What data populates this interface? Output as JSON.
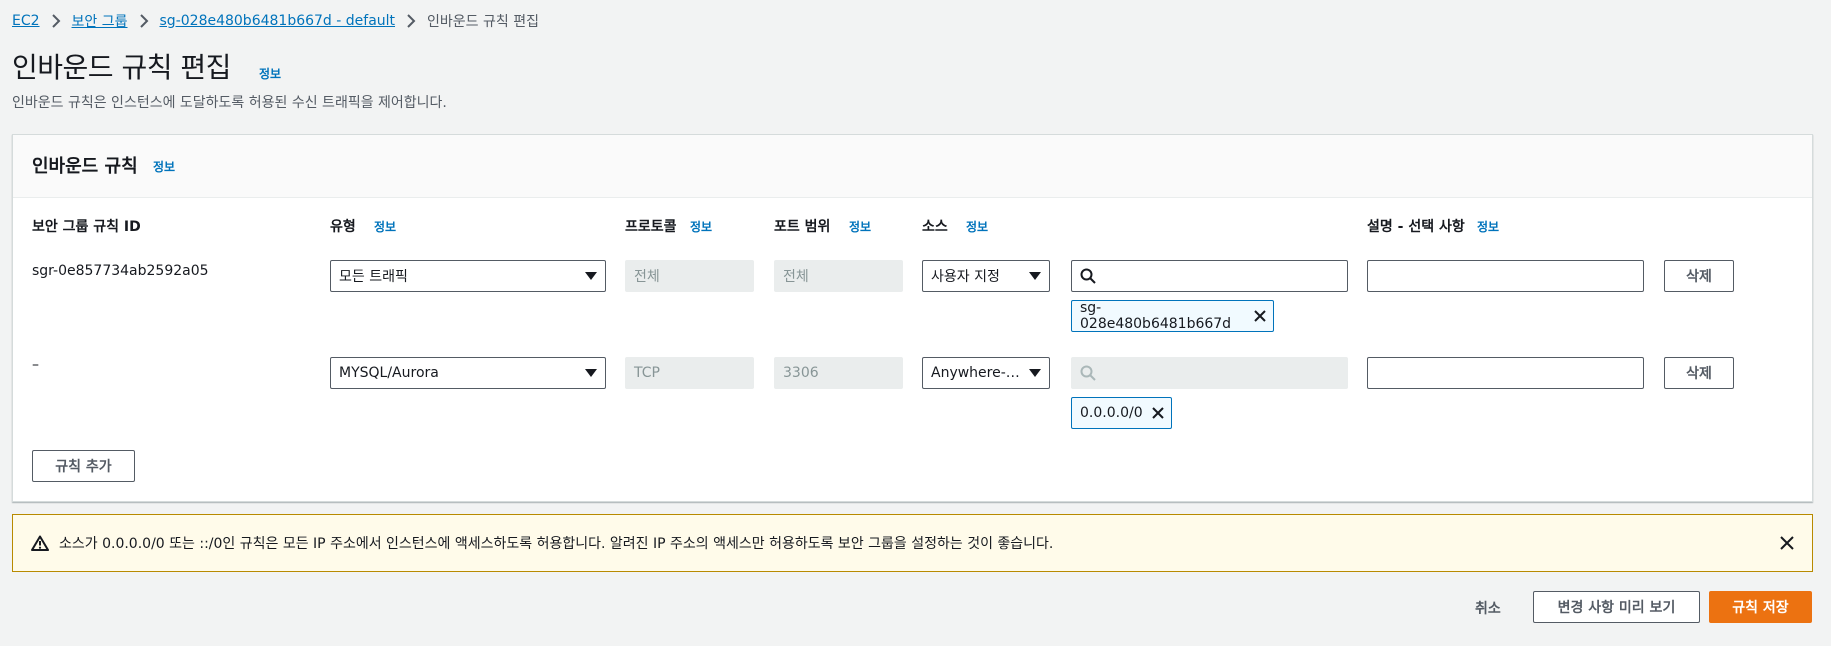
{
  "breadcrumb": {
    "items": [
      {
        "label": "EC2"
      },
      {
        "label": "보안 그룹"
      },
      {
        "label": "sg-028e480b6481b667d - default"
      },
      {
        "label": "인바운드 규칙 편집"
      }
    ]
  },
  "page": {
    "title": "인바운드 규칙 편집",
    "title_info": "정보",
    "description": "인바운드 규칙은 인스턴스에 도달하도록 허용된 수신 트래픽을 제어합니다."
  },
  "panel": {
    "title": "인바운드 규칙",
    "title_info": "정보",
    "columns": {
      "rule_id": "보안 그룹 규칙 ID",
      "type": "유형",
      "type_info": "정보",
      "protocol": "프로토콜",
      "protocol_info": "정보",
      "port_range": "포트 범위",
      "port_range_info": "정보",
      "source": "소스",
      "source_info": "정보",
      "description": "설명 - 선택 사항",
      "description_info": "정보"
    },
    "rows": [
      {
        "rule_id": "sgr-0e857734ab2592a05",
        "type": "모든 트래픽",
        "protocol": "전체",
        "port_range": "전체",
        "source": "사용자 지정",
        "search_value": "",
        "token": "sg-028e480b6481b667d",
        "description": "",
        "delete_label": "삭제"
      },
      {
        "rule_id": "–",
        "type": "MYSQL/Aurora",
        "protocol": "TCP",
        "port_range": "3306",
        "source": "Anywhere-…",
        "search_value": "",
        "token": "0.0.0.0/0",
        "description": "",
        "delete_label": "삭제"
      }
    ],
    "add_rule_label": "규칙 추가"
  },
  "alert": {
    "text": "소스가 0.0.0.0/0 또는 ::/0인 규칙은 모든 IP 주소에서 인스턴스에 액세스하도록 허용합니다. 알려진 IP 주소의 액세스만 허용하도록 보안 그룹을 설정하는 것이 좋습니다."
  },
  "footer": {
    "cancel_label": "취소",
    "preview_label": "변경 사항 미리 보기",
    "save_label": "규칙 저장"
  },
  "colors": {
    "link": "#0073bb",
    "primary": "#ec7211",
    "warning_border": "#b88a00",
    "warning_bg": "#fffbea"
  },
  "icons": {
    "breadcrumb_separator": "chevron-right-icon",
    "dropdown": "caret-down-icon",
    "search": "search-icon",
    "token_remove": "close-icon",
    "warning": "warning-icon",
    "dismiss": "close-icon"
  }
}
